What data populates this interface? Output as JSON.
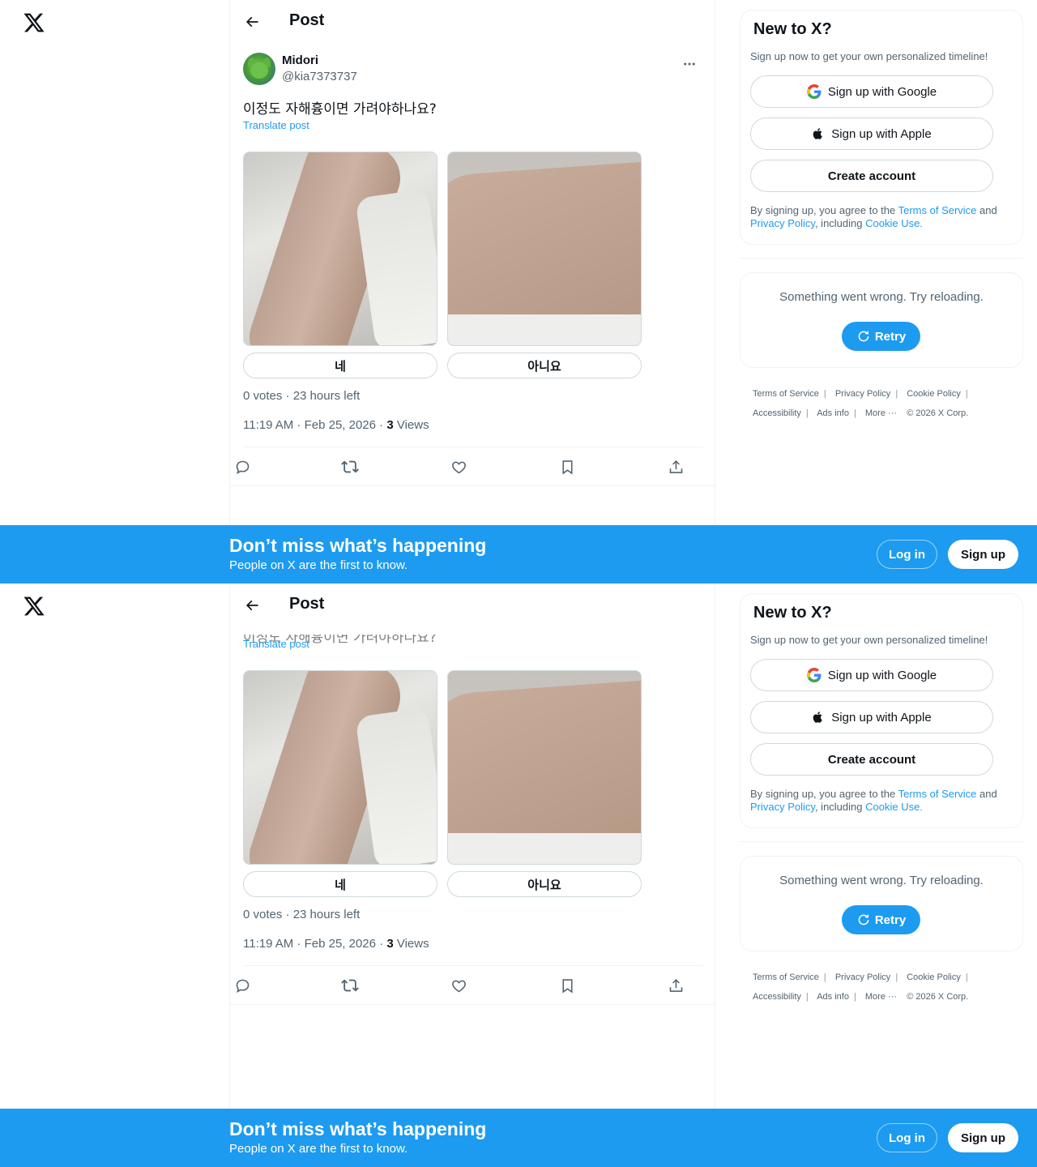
{
  "nav": {
    "logo_icon": "x-logo-icon"
  },
  "header": {
    "title": "Post",
    "back_icon": "arrow-left-icon"
  },
  "post": {
    "author_name": "Midori",
    "author_handle": "@kia7373737",
    "text": "이정도 자해흉이면 가려야하나요?",
    "translate_label": "Translate post",
    "poll_options": [
      "네",
      "아니요"
    ],
    "poll_meta": "0 votes · 23 hours left",
    "time": "11:19 AM · Feb 25, 2026",
    "dot": " · ",
    "views_count": "3",
    "views_label": " Views"
  },
  "actions": [
    "reply-icon",
    "repost-icon",
    "like-icon",
    "bookmark-icon",
    "share-icon"
  ],
  "sidebar": {
    "title": "New to X?",
    "subtitle": "Sign up now to get your own personalized timeline!",
    "google_label": "Sign up with Google",
    "apple_label": "Sign up with Apple",
    "create_label": "Create account",
    "terms": {
      "prefix": "By signing up, you agree to the ",
      "tos": "Terms of Service",
      "and": " and ",
      "privacy": "Privacy Policy",
      "including": ", including ",
      "cookie": "Cookie Use."
    },
    "error_msg": "Something went wrong. Try reloading.",
    "retry_label": "Retry"
  },
  "footer": {
    "terms": "Terms of Service",
    "privacy": "Privacy Policy",
    "cookie": "Cookie Policy",
    "accessibility": "Accessibility",
    "ads": "Ads info",
    "more": "More ···",
    "copyright": "© 2026 X Corp."
  },
  "banner": {
    "headline": "Don’t miss what’s happening",
    "subline": "People on X are the first to know.",
    "login": "Log in",
    "signup": "Sign up"
  },
  "colors": {
    "accent": "#1d9bf0",
    "text": "#0f1419",
    "muted": "#536471",
    "border": "#cfd9de"
  }
}
